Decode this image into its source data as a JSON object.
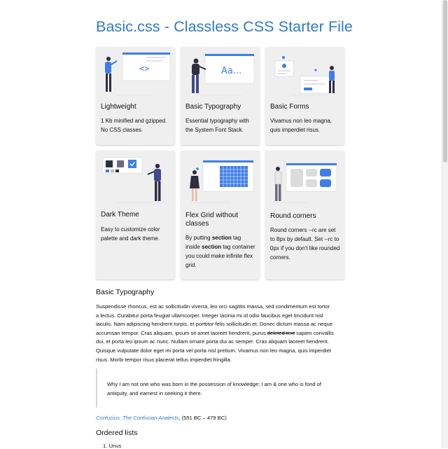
{
  "title": "Basic.css - Classless CSS Starter File",
  "cards": [
    {
      "title": "Lightweight",
      "text": "1 Kb minified and gzipped. No CSS classes.",
      "illustration": "code-window-illustration"
    },
    {
      "title": "Basic Typography",
      "text": "Essential typography with the System Font Stack.",
      "illustration": "typography-illustration",
      "sample_text": "Aa..."
    },
    {
      "title": "Basic Forms",
      "text": "Vivamus non leo magna, quis imperdiet risus.",
      "illustration": "forms-illustration"
    },
    {
      "title": "Dark Theme",
      "text": "Easy to customize color palette and dark theme.",
      "illustration": "palette-illustration"
    },
    {
      "title": "Flex Grid without classes",
      "text_parts": [
        "By putting ",
        "section",
        " tag inside ",
        "section",
        " tag container you could make infinite flex grid."
      ],
      "illustration": "grid-illustration"
    },
    {
      "title": "Round corners",
      "text": "Round corners --rc are set to 8px by default. Set --rc to 0px if you don't like rounded corners.",
      "illustration": "round-corners-illustration"
    }
  ],
  "typography": {
    "heading": "Basic Typography",
    "paragraph_before": "Suspendisse rhoncus, est ac sollicitudin viverra, leo orci sagittis massa, sed condimentum est tortor a lectus. Curabitur porta feugiat ullamcorper. Integer lacinia mi id odio faucibus eget tincidunt nisl iaculis. Nam adipiscing hendrerit turpis, et porttitor felis sollicitudin et. Donec dictum massa ac neque accumsan tempor. Cras aliquam, ipsum sit amet laoreet hendrerit, purus ",
    "paragraph_strike": "deleted text",
    "paragraph_after": " sapien convallis dui, et porta leo ipsum ac nunc. Nullam ornare porta dui ac semper. Cras aliquam laoreet hendrerit. Quisque vulputate dolor eget mi porta vel porta nisl pretium. Vivamus non leo magna, quis imperdiet risus. Morbi tempor risus placerat tellus imperdiet fringilla.",
    "quote": "Why I am not one who was born in the possession of knowledge; I am & one who is fond of antiquity, and earnest in seeking it there.",
    "cite_link": "Confucius, The Confucian Analects",
    "cite_rest": ", (551 BC – 479 BC)"
  },
  "ordered_lists": {
    "heading": "Ordered lists",
    "first_item": "1. Unus"
  },
  "colors": {
    "accent": "#2f7bc8",
    "card_bg": "#efefef",
    "illustration_blue": "#3f7ee8"
  }
}
